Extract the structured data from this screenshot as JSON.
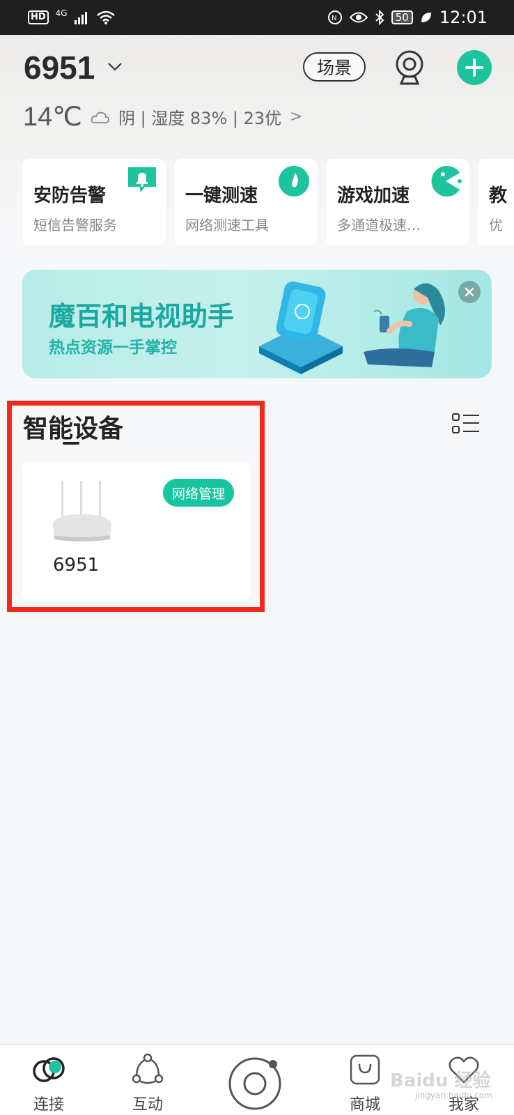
{
  "status_bar": {
    "network_badge": "HD",
    "network_type": "4G",
    "battery": "50",
    "time": "12:01"
  },
  "header": {
    "home_name": "6951",
    "scene_label": "场景"
  },
  "weather": {
    "temperature": "14℃",
    "info": "阴 | 湿度 83% | 23优",
    "arrow": ">"
  },
  "services": [
    {
      "title": "安防告警",
      "subtitle": "短信告警服务",
      "icon": "bell-chat-icon"
    },
    {
      "title": "一键测速",
      "subtitle": "网络测速工具",
      "icon": "speed-drop-icon"
    },
    {
      "title": "游戏加速",
      "subtitle": "多通道极速…",
      "icon": "pacman-icon"
    },
    {
      "title": "教",
      "subtitle": "优",
      "icon": ""
    }
  ],
  "banner": {
    "title": "魔百和电视助手",
    "subtitle": "热点资源一手掌控"
  },
  "devices_section": {
    "title": "智能设备",
    "devices": [
      {
        "name": "6951",
        "badge": "网络管理",
        "icon": "router-icon"
      }
    ]
  },
  "tabbar": {
    "tabs": [
      {
        "label": "连接",
        "icon": "connect-icon"
      },
      {
        "label": "互动",
        "icon": "share-nodes-icon"
      },
      {
        "label": "",
        "icon": "center-ring-icon"
      },
      {
        "label": "商城",
        "icon": "shopping-bag-icon"
      },
      {
        "label": "我家",
        "icon": "home-heart-icon"
      }
    ]
  },
  "watermark": {
    "text": "Baidu 经验",
    "sub": "jingyan.baidu.com"
  },
  "colors": {
    "accent": "#1dc49e",
    "highlight": "#f02a1b",
    "banner_text": "#1aa8a0"
  }
}
